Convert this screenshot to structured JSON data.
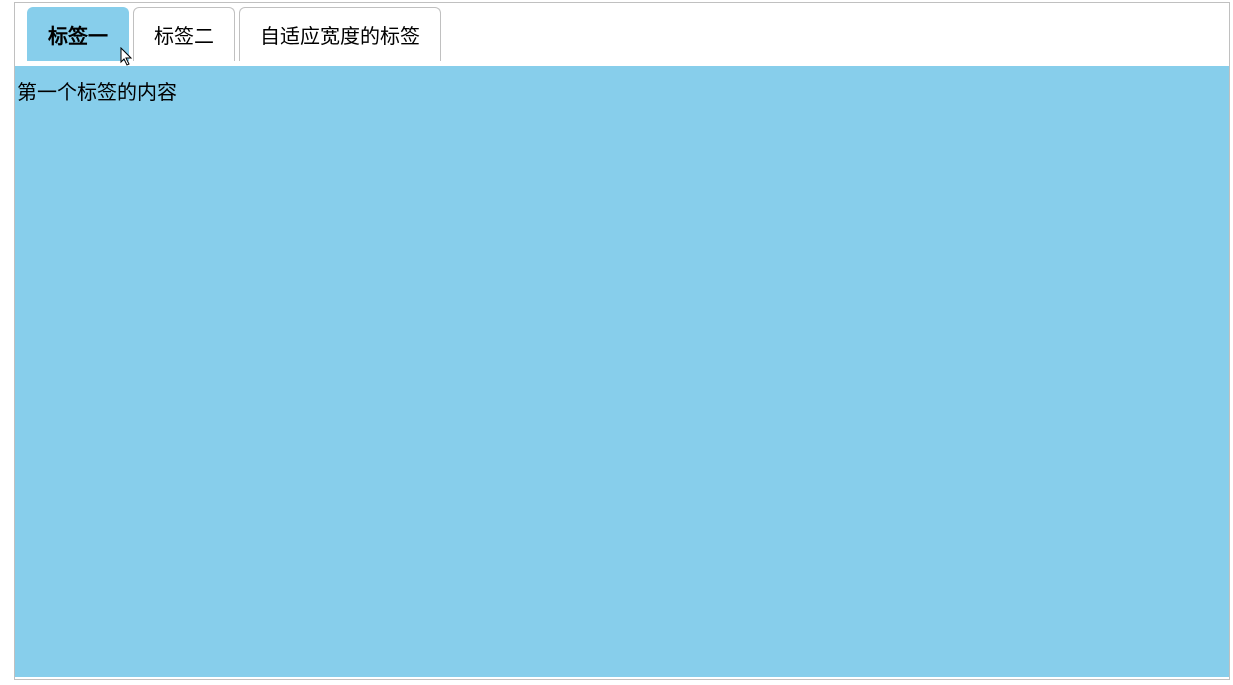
{
  "tabs": [
    {
      "label": "标签一",
      "active": true
    },
    {
      "label": "标签二",
      "active": false
    },
    {
      "label": "自适应宽度的标签",
      "active": false
    }
  ],
  "content": {
    "text": "第一个标签的内容"
  },
  "colors": {
    "active_tab_bg": "#87ceeb",
    "content_bg": "#87ceeb",
    "border": "#c0c0c0"
  }
}
